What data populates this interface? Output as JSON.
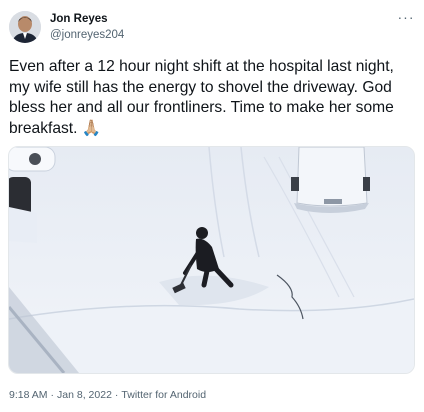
{
  "author": {
    "name": "Jon Reyes",
    "handle": "@jonreyes204"
  },
  "more_label": "···",
  "tweet": {
    "text": "Even after a 12 hour night shift at the hospital last night, my wife still has the energy to shovel the driveway. God bless her and all our frontliners. Time to make her some breakfast.",
    "emoji": "🙏🏼"
  },
  "meta": {
    "time": "9:18 AM",
    "date": "Jan 8, 2022",
    "source": "Twitter for Android",
    "separator": "·"
  },
  "colors": {
    "text": "#0f1419",
    "secondary": "#536471",
    "snow": "#eef2f8",
    "snow_shadow": "#d3dbe8"
  }
}
